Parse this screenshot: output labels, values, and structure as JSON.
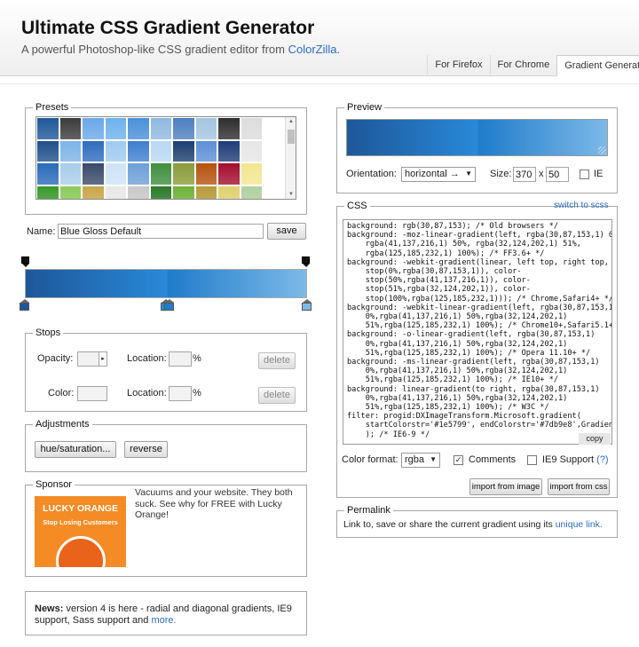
{
  "header": {
    "title": "Ultimate CSS Gradient Generator",
    "subtitle_prefix": "A powerful Photoshop-like CSS gradient editor from ",
    "subtitle_link": "ColorZilla.",
    "tabs": [
      "For Firefox",
      "For Chrome",
      "Gradient Generator"
    ]
  },
  "presets": {
    "legend": "Presets",
    "colors": [
      "#1e5799",
      "#3b3b3b",
      "#6aa8e8",
      "#6cb2eb",
      "#4a90d9",
      "#8fb8e0",
      "#4d7fbf",
      "#a3c4e0",
      "#2d2d2d",
      "#dcdcdc",
      "#1f4f8a",
      "#7cb3e6",
      "#2f6cbf",
      "#9ecbf0",
      "#3f7fd0",
      "#b8d8f4",
      "#1b3f6e",
      "#5c8fd6",
      "#1e3c78",
      "#e6e6e6",
      "#2b6ab8",
      "#a9cdeb",
      "#3a4a6a",
      "#cfe3f6",
      "#6e9fd9",
      "#3e8e3e",
      "#8b9b3a",
      "#b5530f",
      "#a30f2f",
      "#f3e690",
      "#3a9a2a",
      "#8acb5a",
      "#caa64a",
      "#e8e8e8",
      "#c9c9c9",
      "#2b7a2b",
      "#6fb23a",
      "#b79a3a",
      "#e0d070",
      "#b0d0a0"
    ]
  },
  "name_field": {
    "label": "Name:",
    "value": "Blue Gloss Default",
    "save_label": "save"
  },
  "stops": {
    "legend": "Stops",
    "opacity_label": "Opacity:",
    "location_label": "Location:",
    "percent": "%",
    "color_label": "Color:",
    "delete_label": "delete"
  },
  "adjustments": {
    "legend": "Adjustments",
    "hue_label": "hue/saturation...",
    "reverse_label": "reverse"
  },
  "sponsor": {
    "legend": "Sponsor",
    "ad_title": "LUCKY ORANGE",
    "ad_tagline": "Stop Losing Customers",
    "text": "Vacuums and your website. They both suck. See why for FREE with Lucky Orange!"
  },
  "news": {
    "label": "News:",
    "text": " version 4 is here - radial and diagonal gradients, IE9 support, Sass support and ",
    "link": "more."
  },
  "preview": {
    "legend": "Preview",
    "orientation_label": "Orientation:",
    "orientation_value": "horizontal →",
    "size_label": "Size:",
    "width": "370",
    "x_label": "x",
    "height": "50",
    "ie_label": "IE"
  },
  "css_panel": {
    "legend": "CSS",
    "switch_link": "switch to scss",
    "code_lines": [
      "background: rgb(30,87,153); /* Old browsers */",
      "background: -moz-linear-gradient(left, rgba(30,87,153,1) 0%,",
      "    rgba(41,137,216,1) 50%, rgba(32,124,202,1) 51%,",
      "    rgba(125,185,232,1) 100%); /* FF3.6+ */",
      "background: -webkit-gradient(linear, left top, right top, color-",
      "    stop(0%,rgba(30,87,153,1)), color-",
      "    stop(50%,rgba(41,137,216,1)), color-",
      "    stop(51%,rgba(32,124,202,1)), color-",
      "    stop(100%,rgba(125,185,232,1))); /* Chrome,Safari4+ */",
      "background: -webkit-linear-gradient(left, rgba(30,87,153,1)",
      "    0%,rgba(41,137,216,1) 50%,rgba(32,124,202,1)",
      "    51%,rgba(125,185,232,1) 100%); /* Chrome10+,Safari5.1+ */",
      "background: -o-linear-gradient(left, rgba(30,87,153,1)",
      "    0%,rgba(41,137,216,1) 50%,rgba(32,124,202,1)",
      "    51%,rgba(125,185,232,1) 100%); /* Opera 11.10+ */",
      "background: -ms-linear-gradient(left, rgba(30,87,153,1)",
      "    0%,rgba(41,137,216,1) 50%,rgba(32,124,202,1)",
      "    51%,rgba(125,185,232,1) 100%); /* IE10+ */",
      "background: linear-gradient(to right, rgba(30,87,153,1)",
      "    0%,rgba(41,137,216,1) 50%,rgba(32,124,202,1)",
      "    51%,rgba(125,185,232,1) 100%); /* W3C */",
      "filter: progid:DXImageTransform.Microsoft.gradient(",
      "    startColorstr='#1e5799', endColorstr='#7db9e8',GradientType=1",
      "    ); /* IE6-9 */"
    ],
    "copy_label": "copy",
    "format_label": "Color format:",
    "format_value": "rgba",
    "comments_label": "Comments",
    "ie9_label": "IE9 Support",
    "ie9_help": "(?)",
    "import_image_label": "import from image",
    "import_css_label": "import from css"
  },
  "permalink": {
    "legend": "Permalink",
    "text": "Link to, save or share the current gradient using its ",
    "link": "unique link."
  }
}
